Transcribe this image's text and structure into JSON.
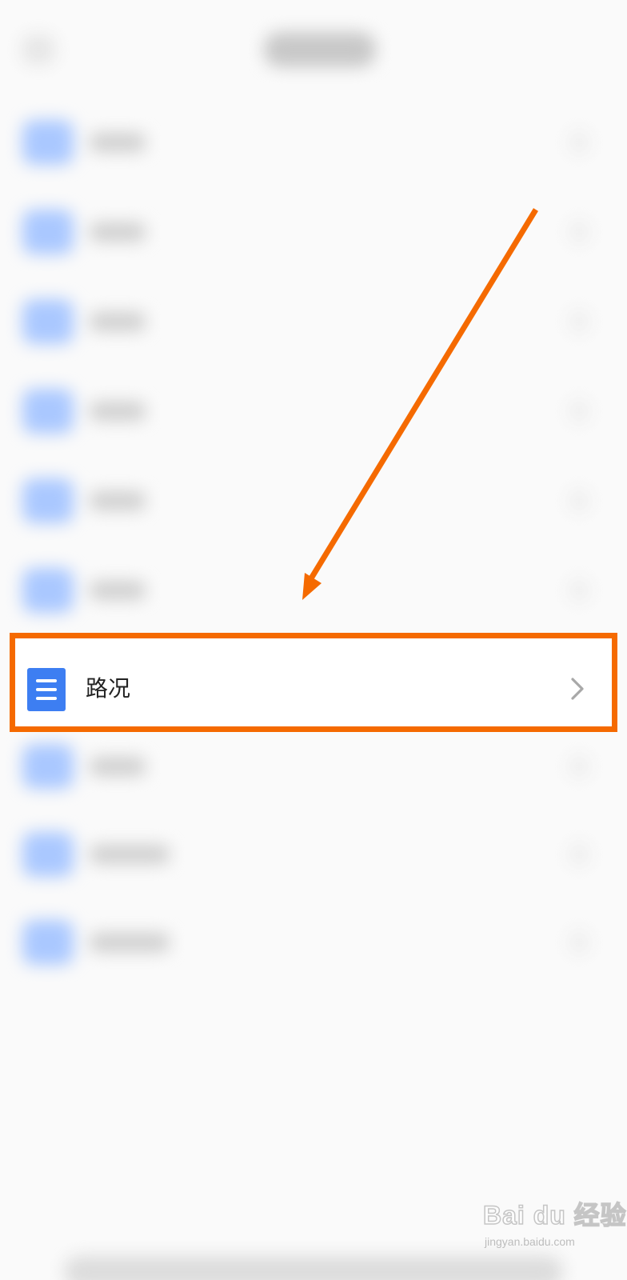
{
  "highlighted_item": {
    "label": "路况",
    "icon": "list-icon",
    "chevron_icon": "chevron-right-icon"
  },
  "colors": {
    "highlight_border": "#f56a00",
    "arrow": "#f56a00",
    "icon_background": "#3d7ef2",
    "page_background": "#fafafa"
  },
  "watermark": {
    "brand": "Bai du 经验",
    "url": "jingyan.baidu.com"
  }
}
